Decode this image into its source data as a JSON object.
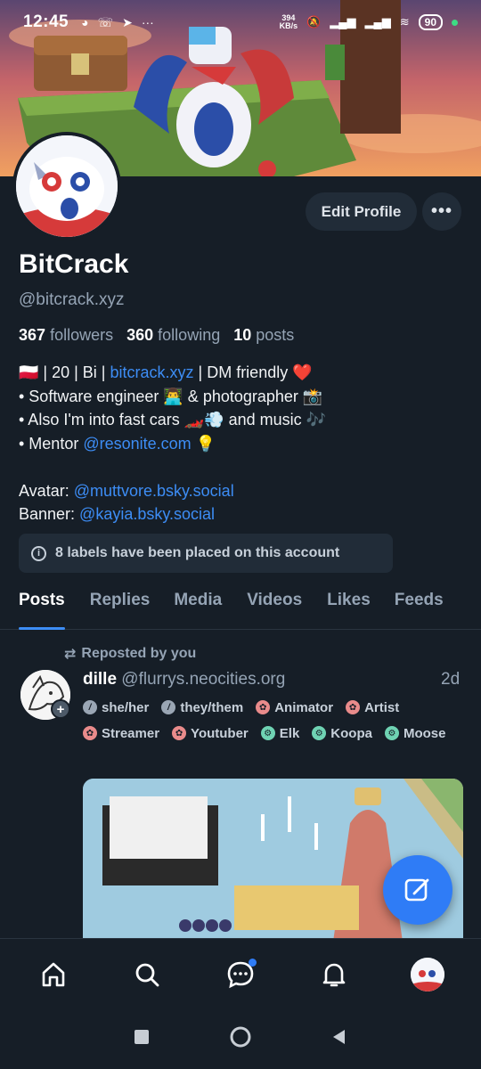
{
  "status_bar": {
    "time": "12:45",
    "net_speed_value": "394",
    "net_speed_unit": "KB/s",
    "battery": "90"
  },
  "profile": {
    "display_name": "BitCrack",
    "handle": "@bitcrack.xyz",
    "edit_button": "Edit Profile",
    "more_button": "•••",
    "followers_count": "367",
    "followers_label": "followers",
    "following_count": "360",
    "following_label": "following",
    "posts_count": "10",
    "posts_label": "posts",
    "bio": {
      "line1_pre": "🇵🇱 | 20 | Bi | ",
      "line1_link": "bitcrack.xyz",
      "line1_post": " | DM friendly ❤️",
      "line2": "• Software engineer 👨‍💻 & photographer 📸",
      "line3": "• Also I'm into fast cars 🏎️💨 and music 🎶",
      "line4_pre": "• Mentor ",
      "line4_link": "@resonite.com",
      "line4_post": " 💡",
      "avatar_label": "Avatar: ",
      "avatar_link": "@muttvore.bsky.social",
      "banner_label": "Banner: ",
      "banner_link": "@kayia.bsky.social"
    },
    "labels_notice": "8 labels have been placed on this account"
  },
  "tabs": [
    "Posts",
    "Replies",
    "Media",
    "Videos",
    "Likes",
    "Feeds"
  ],
  "active_tab": "Posts",
  "post": {
    "repost_label": "Reposted by you",
    "author_name": "dille",
    "author_handle": "@flurrys.neocities.org",
    "time": "2d",
    "labels": [
      {
        "text": "she/her",
        "kind": "pron"
      },
      {
        "text": "they/them",
        "kind": "pron"
      },
      {
        "text": "Animator",
        "kind": "role"
      },
      {
        "text": "Artist",
        "kind": "role"
      },
      {
        "text": "Streamer",
        "kind": "role"
      },
      {
        "text": "Youtuber",
        "kind": "role"
      },
      {
        "text": "Elk",
        "kind": "spec"
      },
      {
        "text": "Koopa",
        "kind": "spec"
      },
      {
        "text": "Moose",
        "kind": "spec"
      }
    ]
  },
  "icons": {
    "bottom_nav": [
      "home-icon",
      "search-icon",
      "chat-icon",
      "bell-icon",
      "profile-avatar"
    ],
    "fab": "compose-icon"
  },
  "colors": {
    "background": "#161e27",
    "accent": "#3d8df5",
    "fab": "#2f7cf6",
    "muted_text": "#95a4b5"
  }
}
